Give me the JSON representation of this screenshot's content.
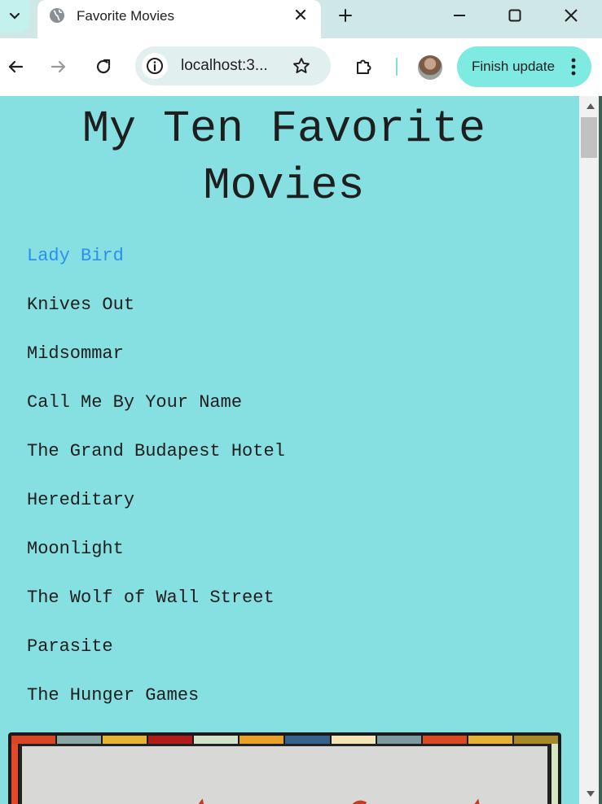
{
  "browser": {
    "tab": {
      "title": "Favorite Movies"
    },
    "address_bar": {
      "url_display": "localhost:3..."
    },
    "update_button": {
      "label": "Finish update"
    }
  },
  "page": {
    "title": "My Ten Favorite Movies",
    "movies": [
      "Lady Bird",
      "Knives Out",
      "Midsommar",
      "Call Me By Your Name",
      "The Grand Budapest Hotel",
      "Hereditary",
      "Moonlight",
      "The Wolf of Wall Street",
      "Parasite",
      "The Hunger Games"
    ],
    "colors": {
      "background": "#86dfe0",
      "text": "#1e1e1e",
      "active_link": "#2b8ff0"
    }
  }
}
